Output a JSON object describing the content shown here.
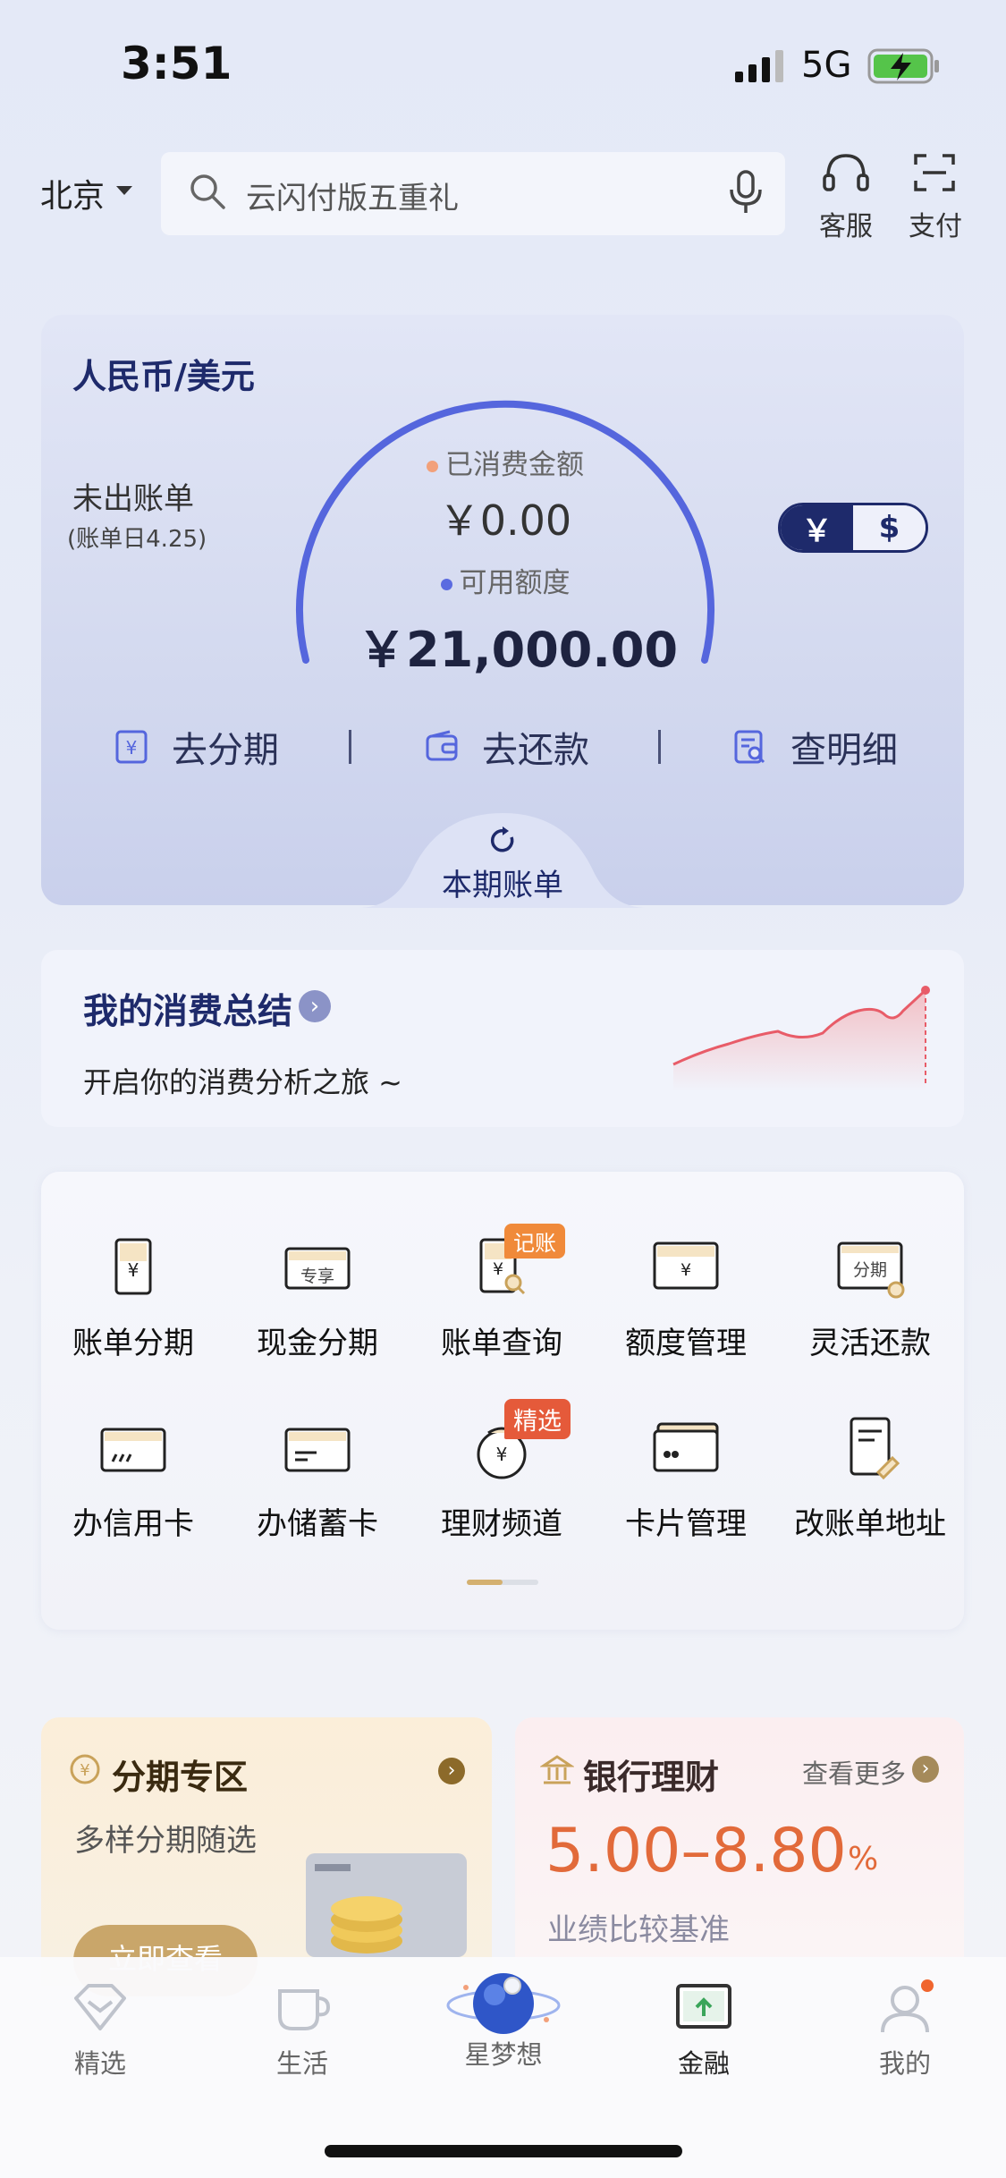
{
  "status_bar": {
    "time": "3:51",
    "network": "5G"
  },
  "header": {
    "city": "北京",
    "search_placeholder": "云闪付版五重礼",
    "service_label": "客服",
    "pay_label": "支付"
  },
  "credit_card": {
    "currency_title": "人民币/美元",
    "unbilled_label": "未出账单",
    "bill_day": "(账单日4.25)",
    "spent_label": "已消费金额",
    "spent_value": "￥0.00",
    "available_label": "可用额度",
    "available_value": "￥21,000.00",
    "available_fraction": 1.0,
    "currency_toggle": [
      "￥",
      "$"
    ],
    "actions": [
      "去分期",
      "去还款",
      "查明细"
    ],
    "bill_tab_label": "本期账单",
    "colors": {
      "spent_dot": "#f2a07a",
      "available_dot": "#5b6be0",
      "gauge": "#5566dd"
    }
  },
  "summary": {
    "title": "我的消费总结",
    "subtitle": "开启你的消费分析之旅 ~"
  },
  "services": {
    "row1": [
      {
        "label": "账单分期",
        "icon": "bill-installment-icon"
      },
      {
        "label": "现金分期",
        "icon": "cash-installment-icon"
      },
      {
        "label": "账单查询",
        "icon": "bill-query-icon",
        "badge": "记账"
      },
      {
        "label": "额度管理",
        "icon": "limit-management-icon"
      },
      {
        "label": "灵活还款",
        "icon": "flexible-repay-icon"
      }
    ],
    "row2": [
      {
        "label": "办信用卡",
        "icon": "credit-card-apply-icon"
      },
      {
        "label": "办储蓄卡",
        "icon": "debit-card-apply-icon"
      },
      {
        "label": "理财频道",
        "icon": "wealth-channel-icon",
        "badge": "精选"
      },
      {
        "label": "卡片管理",
        "icon": "card-management-icon"
      },
      {
        "label": "改账单地址",
        "icon": "change-address-icon"
      }
    ],
    "icon_glyphs": {
      "yuan": "¥",
      "vip": "专享",
      "installment": "分期"
    }
  },
  "promo_installment": {
    "title": "分期专区",
    "subtitle": "多样分期随选",
    "button": "立即查看"
  },
  "promo_wealth": {
    "title": "银行理财",
    "more": "查看更多",
    "rate": "5.00–8.80",
    "rate_unit": "%",
    "subtitle": "业绩比较基准"
  },
  "tabbar": {
    "tabs": [
      "精选",
      "生活",
      "星梦想",
      "金融",
      "我的"
    ]
  }
}
